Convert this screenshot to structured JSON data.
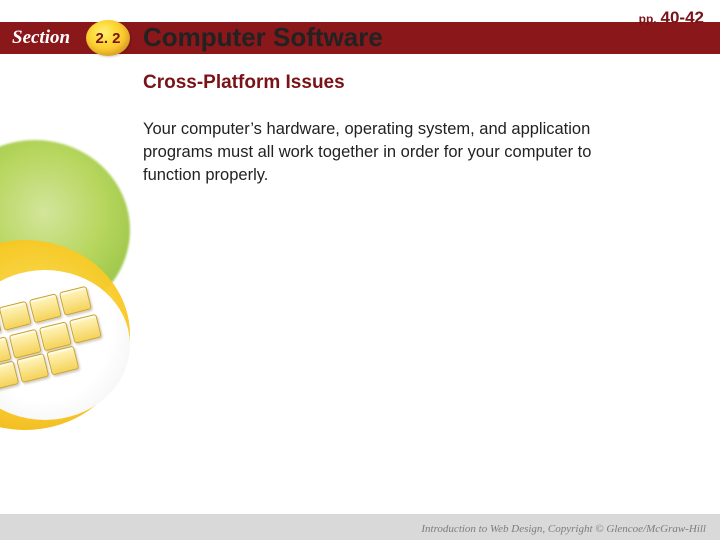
{
  "header": {
    "section_label": "Section",
    "section_number": "2. 2",
    "chapter_title": "Computer Software",
    "page_prefix": "pp.",
    "page_numbers": "40-42"
  },
  "content": {
    "subtitle": "Cross-Platform Issues",
    "body": "Your computer’s hardware, operating system, and application programs must all work together in order for your computer to function properly."
  },
  "footer": {
    "copyright": "Introduction to Web Design, Copyright © Glencoe/McGraw-Hill"
  }
}
